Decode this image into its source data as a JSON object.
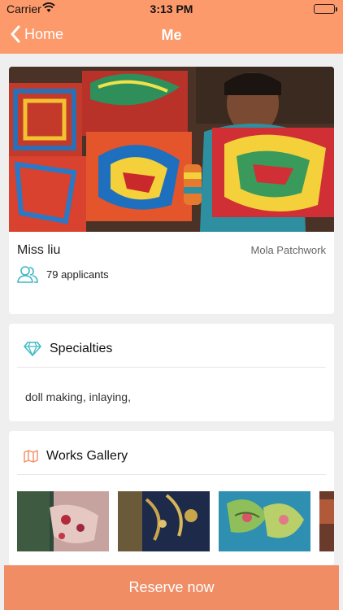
{
  "status": {
    "carrier": "Carrier",
    "time": "3:13 PM"
  },
  "nav": {
    "back_label": "Home",
    "title": "Me"
  },
  "profile": {
    "name": "Miss liu",
    "craft": "Mola Patchwork",
    "applicants": "79 applicants"
  },
  "specialties": {
    "heading": "Specialties",
    "text": "doll making, inlaying,"
  },
  "gallery": {
    "heading": "Works Gallery"
  },
  "reserve": {
    "label": "Reserve now"
  },
  "colors": {
    "accent": "#fd9a6c",
    "button": "#f08d65",
    "teal_icon": "#3fb8c4"
  },
  "icons": [
    "chevron-left-icon",
    "wifi-icon",
    "battery-icon",
    "people-icon",
    "diamond-icon",
    "map-icon"
  ]
}
